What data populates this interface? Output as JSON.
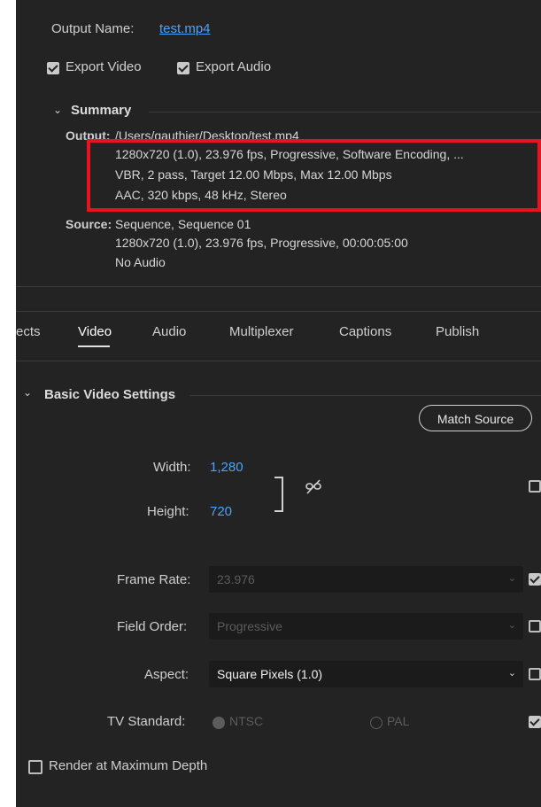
{
  "output": {
    "name_label": "Output Name:",
    "name_value": "test.mp4",
    "export_video_label": "Export Video",
    "export_audio_label": "Export Audio",
    "export_video_checked": true,
    "export_audio_checked": true
  },
  "summary": {
    "title": "Summary",
    "output_label": "Output:",
    "output_path": "/Users/gauthier/Desktop/test.mp4",
    "output_lines": [
      "1280x720 (1.0), 23.976 fps, Progressive, Software Encoding, ...",
      "VBR, 2 pass, Target 12.00 Mbps, Max 12.00 Mbps",
      "AAC, 320 kbps, 48 kHz, Stereo"
    ],
    "source_label": "Source:",
    "source_first": "Sequence, Sequence 01",
    "source_lines": [
      "1280x720 (1.0), 23.976 fps, Progressive, 00:00:05:00",
      "No Audio"
    ]
  },
  "tabs": [
    {
      "label": "ects",
      "active": false
    },
    {
      "label": "Video",
      "active": true
    },
    {
      "label": "Audio",
      "active": false
    },
    {
      "label": "Multiplexer",
      "active": false
    },
    {
      "label": "Captions",
      "active": false
    },
    {
      "label": "Publish",
      "active": false
    }
  ],
  "basic_video": {
    "title": "Basic Video Settings",
    "match_source_label": "Match Source",
    "width_label": "Width:",
    "width_value": "1,280",
    "height_label": "Height:",
    "height_value": "720",
    "frame_rate_label": "Frame Rate:",
    "frame_rate_value": "23.976",
    "field_order_label": "Field Order:",
    "field_order_value": "Progressive",
    "aspect_label": "Aspect:",
    "aspect_value": "Square Pixels (1.0)",
    "tv_standard_label": "TV Standard:",
    "ntsc_label": "NTSC",
    "pal_label": "PAL",
    "render_max_depth_label": "Render at Maximum Depth"
  },
  "colors": {
    "panel_bg": "#232323",
    "link": "#4aa3ff",
    "highlight_box": "#e5141f"
  }
}
